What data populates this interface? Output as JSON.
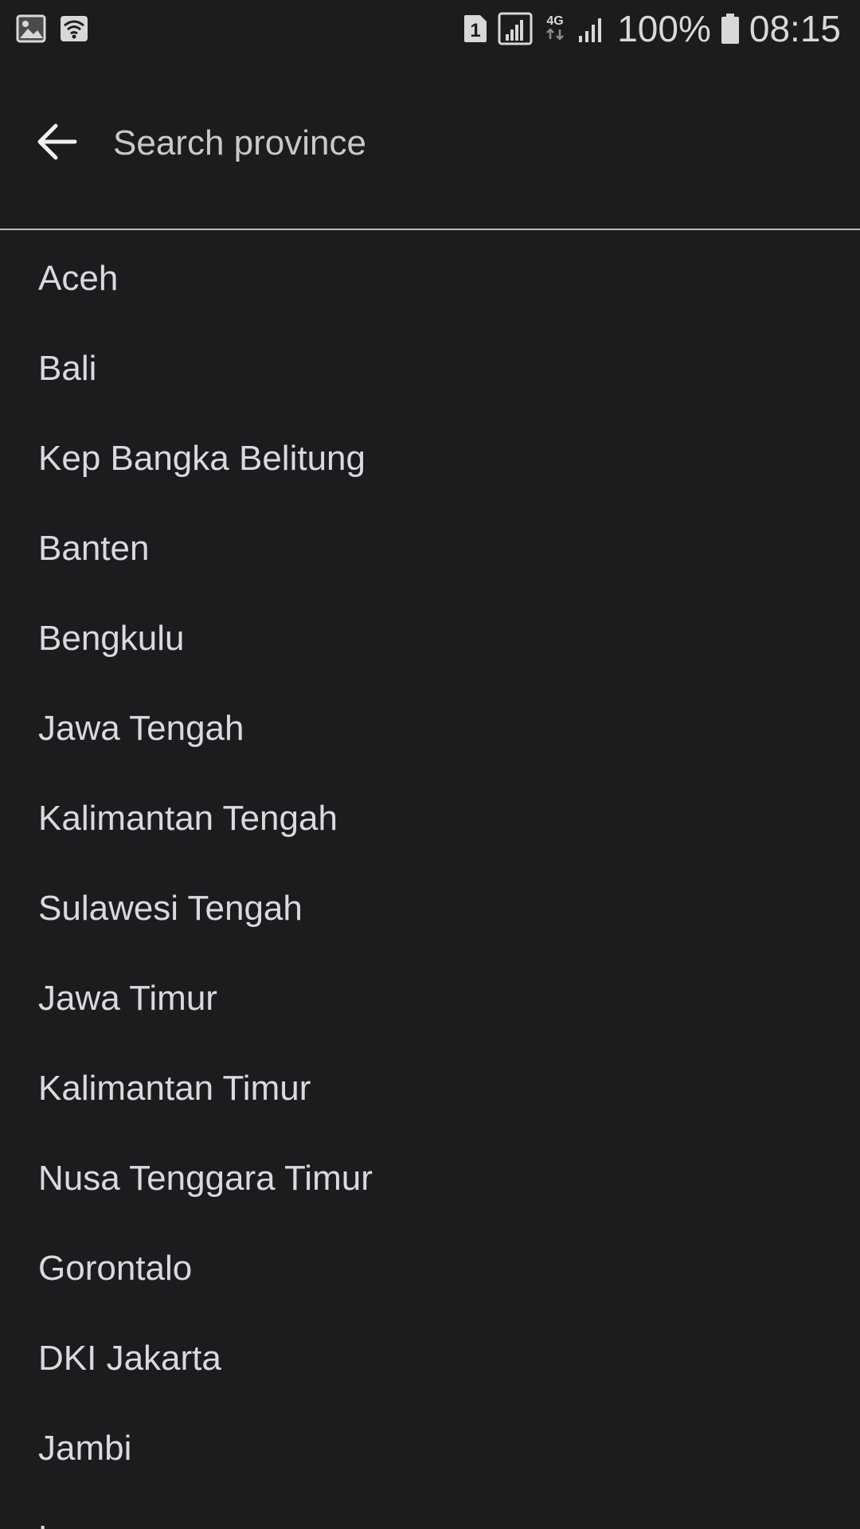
{
  "status_bar": {
    "left_icons": [
      "image-icon",
      "wifi-icon"
    ],
    "right_icons": [
      "sim1-icon",
      "signal-icon",
      "4g-icon",
      "signal-icon"
    ],
    "network_label": "4G",
    "sim_label": "1",
    "battery_percent": "100%",
    "time": "08:15"
  },
  "search": {
    "placeholder": "Search province",
    "value": ""
  },
  "provinces": [
    "Aceh",
    "Bali",
    "Kep Bangka Belitung",
    "Banten",
    "Bengkulu",
    "Jawa Tengah",
    "Kalimantan Tengah",
    "Sulawesi Tengah",
    "Jawa Timur",
    "Kalimantan Timur",
    "Nusa Tenggara Timur",
    "Gorontalo",
    "DKI Jakarta",
    "Jambi",
    "L"
  ],
  "colors": {
    "background": "#1c1c1e",
    "text": "#dcd7e0",
    "divider": "#bdbdbd"
  }
}
